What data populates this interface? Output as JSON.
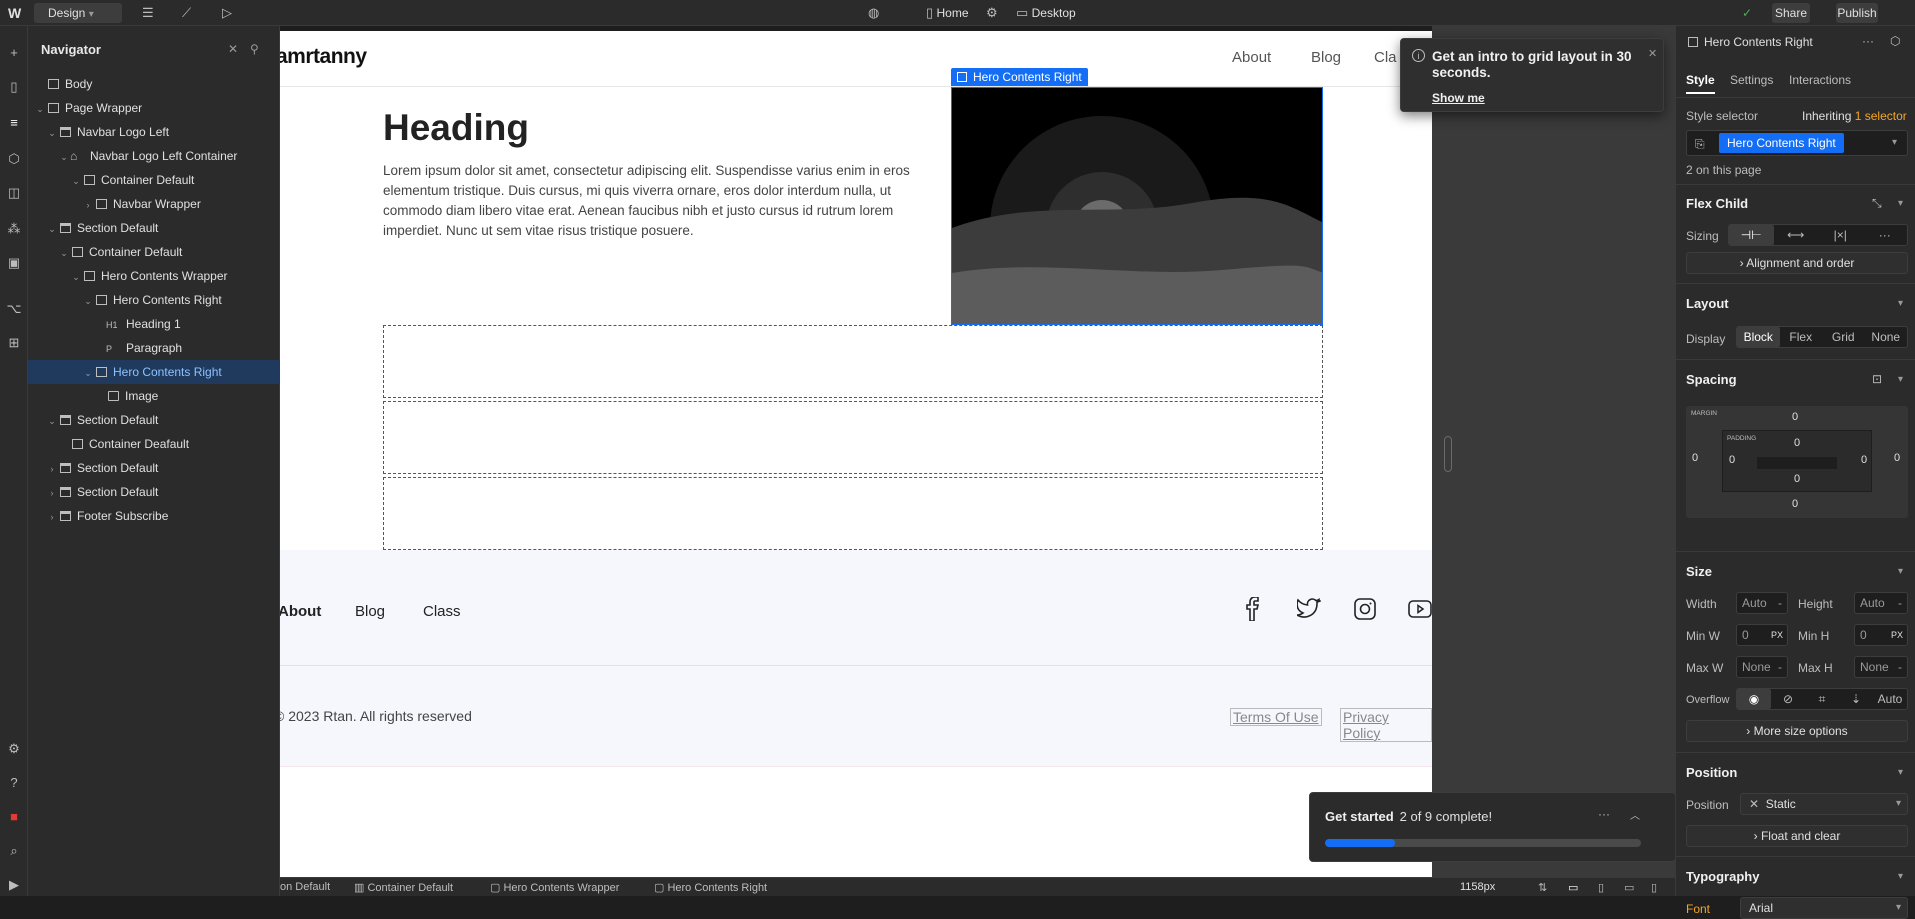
{
  "topbar": {
    "mode_label": "Design",
    "page_label": "Home",
    "breakpoint_label": "Desktop",
    "share_label": "Share",
    "publish_label": "Publish"
  },
  "navigator": {
    "title": "Navigator",
    "items": [
      {
        "label": "Body",
        "depth": 0,
        "caret": "",
        "icon": "box"
      },
      {
        "label": "Page Wrapper",
        "depth": 0,
        "caret": "v",
        "icon": "box"
      },
      {
        "label": "Navbar Logo Left",
        "depth": 1,
        "caret": "v",
        "icon": "section"
      },
      {
        "label": "Navbar Logo Left Container",
        "depth": 2,
        "caret": "v",
        "icon": "component"
      },
      {
        "label": "Container Default",
        "depth": 3,
        "caret": "v",
        "icon": "box"
      },
      {
        "label": "Navbar Wrapper",
        "depth": 4,
        "caret": ">",
        "icon": "box"
      },
      {
        "label": "Section Default",
        "depth": 1,
        "caret": "v",
        "icon": "section"
      },
      {
        "label": "Container Default",
        "depth": 2,
        "caret": "v",
        "icon": "container"
      },
      {
        "label": "Hero Contents Wrapper",
        "depth": 3,
        "caret": "v",
        "icon": "box"
      },
      {
        "label": "Hero Contents Right",
        "depth": 4,
        "caret": "v",
        "icon": "box"
      },
      {
        "label": "Heading 1",
        "depth": 5,
        "caret": "",
        "icon": "H1"
      },
      {
        "label": "Paragraph",
        "depth": 5,
        "caret": "",
        "icon": "P"
      },
      {
        "label": "Hero Contents Right",
        "depth": 4,
        "caret": "v",
        "icon": "box",
        "selected": true
      },
      {
        "label": "Image",
        "depth": 5,
        "caret": "",
        "icon": "image"
      },
      {
        "label": "Section Default",
        "depth": 1,
        "caret": "v",
        "icon": "section"
      },
      {
        "label": "Container Deafault",
        "depth": 2,
        "caret": "",
        "icon": "container"
      },
      {
        "label": "Section Default",
        "depth": 1,
        "caret": ">",
        "icon": "section"
      },
      {
        "label": "Section Default",
        "depth": 1,
        "caret": ">",
        "icon": "section"
      },
      {
        "label": "Footer Subscribe",
        "depth": 1,
        "caret": ">",
        "icon": "section"
      }
    ]
  },
  "canvas": {
    "logo": "amrtanny",
    "nav_links": [
      "About",
      "Blog",
      "Cla"
    ],
    "selection_label": "Hero Contents Right",
    "heading": "Heading",
    "paragraph": "Lorem ipsum dolor sit amet, consectetur adipiscing elit. Suspendisse varius enim in eros elementum tristique. Duis cursus, mi quis viverra ornare, eros dolor interdum nulla, ut commodo diam libero vitae erat. Aenean faucibus nibh et justo cursus id rutrum lorem imperdiet. Nunc ut sem vitae risus tristique posuere.",
    "footer_links": [
      "About",
      "Blog",
      "Class"
    ],
    "copyright": "© 2023 Rtan. All rights reserved",
    "terms": "Terms Of Use",
    "privacy": "Privacy Policy"
  },
  "toast": {
    "title": "Get an intro to grid layout in 30 seconds.",
    "link": "Show me"
  },
  "get_started": {
    "title": "Get started",
    "progress_text": "2 of 9 complete!",
    "progress_fraction": 0.222
  },
  "bottombar": {
    "crumbs": [
      "on Default",
      "Container Default",
      "Hero Contents Wrapper",
      "Hero Contents Right"
    ],
    "width_label": "1158px"
  },
  "rightpanel": {
    "element_name": "Hero Contents Right",
    "tabs": [
      "Style",
      "Settings",
      "Interactions"
    ],
    "style_selector_label": "Style selector",
    "inheriting_prefix": "Inheriting",
    "inheriting_count": "1",
    "inheriting_suffix": "selector",
    "selector_chip": "Hero Contents Right",
    "on_page": "2 on this page",
    "flex_child": {
      "title": "Flex Child",
      "sizing_label": "Sizing",
      "alignment_label": "Alignment and order"
    },
    "layout": {
      "title": "Layout",
      "display_label": "Display",
      "options": [
        "Block",
        "Flex",
        "Grid",
        "None"
      ]
    },
    "spacing": {
      "title": "Spacing",
      "margin_label": "MARGIN",
      "padding_label": "PADDING",
      "margin_top": "0",
      "margin_right": "0",
      "margin_bottom": "0",
      "margin_left": "0",
      "padding_top": "0",
      "padding_right": "0",
      "padding_bottom": "0",
      "padding_left": "0"
    },
    "size": {
      "title": "Size",
      "width_label": "Width",
      "width_value": "Auto",
      "height_label": "Height",
      "height_value": "Auto",
      "minw_label": "Min W",
      "minw_value": "0",
      "minw_unit": "PX",
      "minh_label": "Min H",
      "minh_value": "0",
      "minh_unit": "PX",
      "maxw_label": "Max W",
      "maxw_value": "None",
      "maxh_label": "Max H",
      "maxh_value": "None",
      "overflow_label": "Overflow",
      "overflow_auto": "Auto",
      "more_label": "More size options"
    },
    "position": {
      "title": "Position",
      "position_label": "Position",
      "position_value": "Static",
      "float_label": "Float and clear"
    },
    "typography": {
      "title": "Typography",
      "font_label": "Font",
      "font_value": "Arial"
    }
  },
  "colors": {
    "accent": "#146ef5",
    "selector_orange": "#f5a623",
    "font_orange": "#f5a623"
  }
}
